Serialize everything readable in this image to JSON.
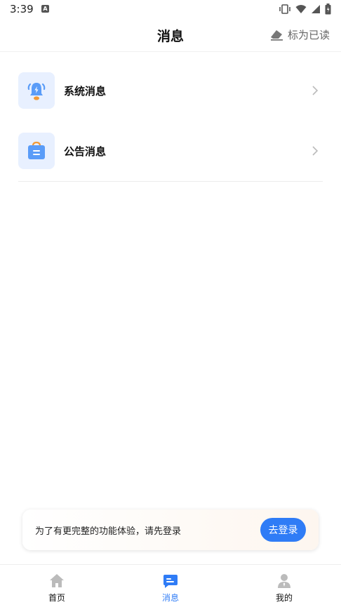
{
  "status_bar": {
    "time": "3:39",
    "badge": "A"
  },
  "header": {
    "title": "消息",
    "mark_read_label": "标为已读"
  },
  "messages": [
    {
      "label": "系统消息",
      "icon": "bell-icon"
    },
    {
      "label": "公告消息",
      "icon": "announcement-bag-icon"
    }
  ],
  "login_banner": {
    "text": "为了有更完整的功能体验，请先登录",
    "button_label": "去登录"
  },
  "tabs": [
    {
      "label": "首页",
      "icon": "home-icon",
      "active": false
    },
    {
      "label": "消息",
      "icon": "message-icon",
      "active": true
    },
    {
      "label": "我的",
      "icon": "profile-icon",
      "active": false
    }
  ],
  "colors": {
    "accent": "#2f7cf6",
    "icon_bg": "#e8f0ff",
    "icon_blue": "#5a9cf8",
    "icon_orange": "#f29a38"
  }
}
